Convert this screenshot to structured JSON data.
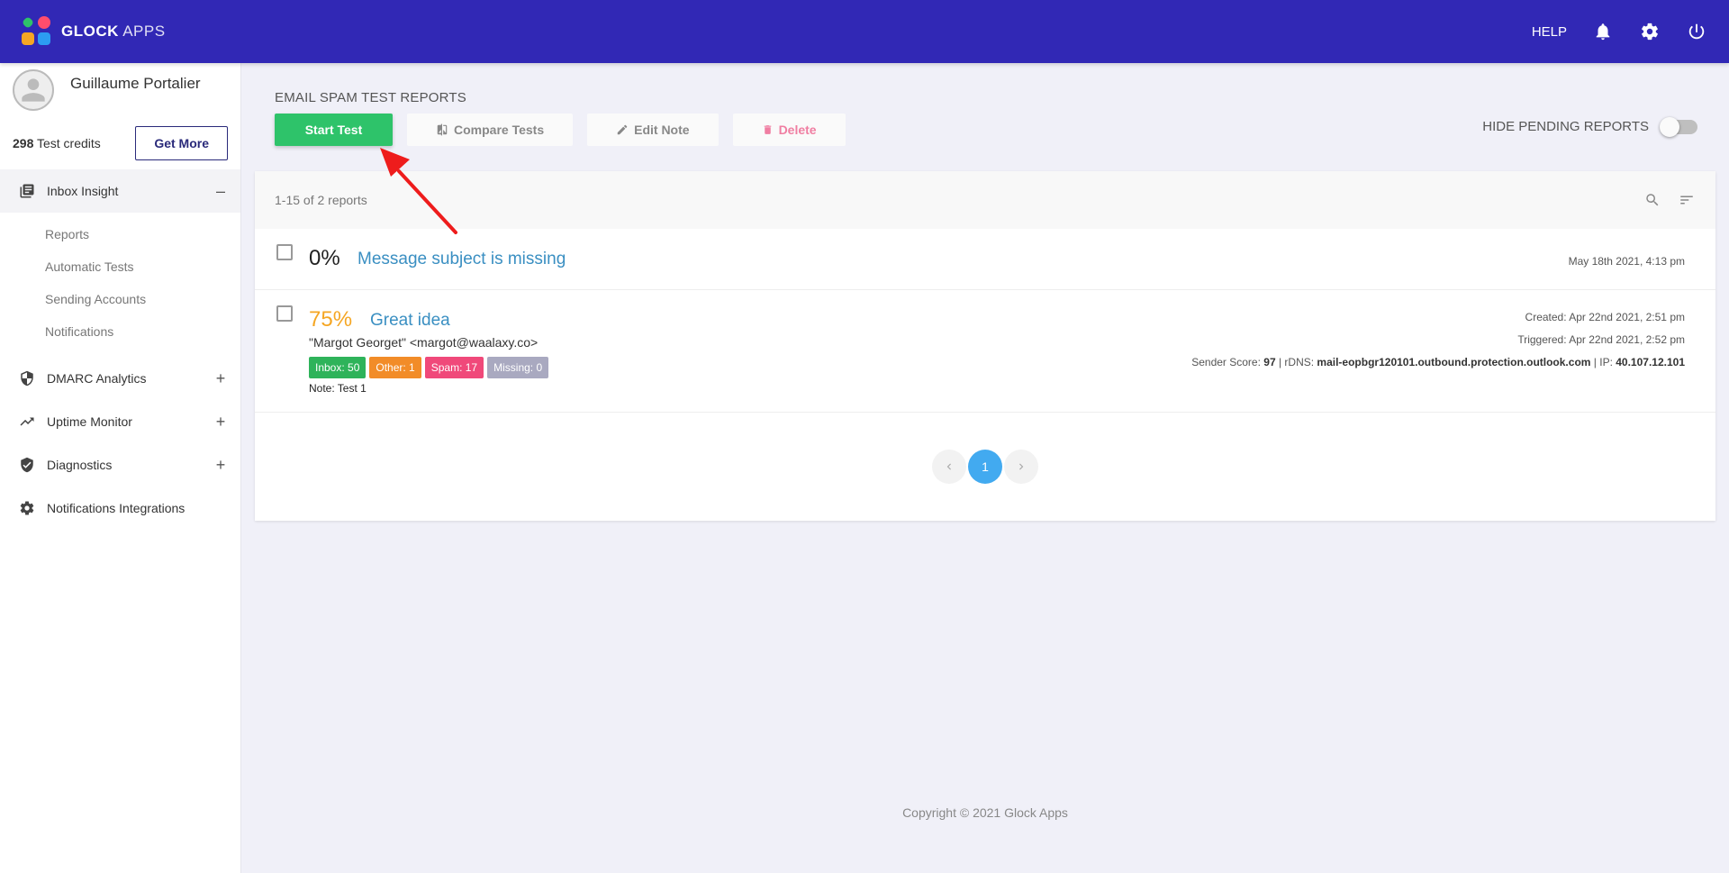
{
  "app": {
    "brand_bold": "GLOCK",
    "brand_light": "APPS",
    "help_label": "HELP"
  },
  "profile": {
    "name": "Guillaume Portalier",
    "credits_count": "298",
    "credits_label": " Test credits",
    "get_more_label": "Get More"
  },
  "sidebar": {
    "inbox_insight": {
      "label": "Inbox Insight",
      "toggle": "–",
      "items": [
        "Reports",
        "Automatic Tests",
        "Sending Accounts",
        "Notifications"
      ]
    },
    "dmarc": {
      "label": "DMARC Analytics",
      "toggle": "+"
    },
    "uptime": {
      "label": "Uptime Monitor",
      "toggle": "+"
    },
    "diagnostics": {
      "label": "Diagnostics",
      "toggle": "+"
    },
    "integrations": {
      "label": "Notifications Integrations"
    }
  },
  "main": {
    "section_title": "EMAIL SPAM TEST REPORTS",
    "start_test_label": "Start Test",
    "compare_tests_label": "Compare Tests",
    "edit_note_label": "Edit Note",
    "delete_label": "Delete",
    "hide_pending_label": "HIDE PENDING REPORTS",
    "count_text": "1-15 of 2 reports"
  },
  "reports": [
    {
      "percent": "0%",
      "subject": "Message subject is missing",
      "date": "May 18th 2021, 4:13 pm"
    },
    {
      "percent": "75%",
      "subject": "Great idea",
      "sender": "\"Margot Georget\" <margot@waalaxy.co>",
      "badges": {
        "inbox": "Inbox: 50",
        "other": "Other: 1",
        "spam": "Spam: 17",
        "missing": "Missing: 0"
      },
      "note": "Note: Test 1",
      "created": "Created: Apr 22nd 2021, 2:51 pm",
      "triggered": "Triggered: Apr 22nd 2021, 2:52 pm",
      "sender_score_label": "Sender Score: ",
      "sender_score": "97",
      "rdns_label": " | rDNS: ",
      "rdns": "mail-eopbgr120101.outbound.protection.outlook.com",
      "ip_label": " | IP: ",
      "ip": "40.107.12.101"
    }
  ],
  "pagination": {
    "current_page": "1"
  },
  "footer": {
    "copyright": "Copyright © 2021 Glock Apps"
  },
  "colors": {
    "topbar": "#3128b5",
    "primary_green": "#2ec36a",
    "link_blue": "#3a8fc2",
    "warning_orange": "#f5a623",
    "annotation_arrow": "#ee1c1c"
  }
}
